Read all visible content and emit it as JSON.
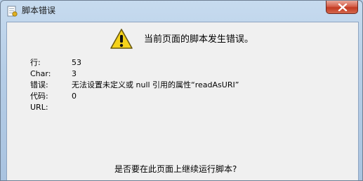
{
  "window": {
    "title": "脚本错误",
    "close_icon": "close-icon"
  },
  "dialog": {
    "icon": "warning-icon",
    "headline": "当前页面的脚本发生错误。",
    "details": [
      {
        "label": "行:",
        "value": "53"
      },
      {
        "label": "Char:",
        "value": "3"
      },
      {
        "label": "错误:",
        "value": "无法设置未定义或 null 引用的属性“readAsURI”"
      },
      {
        "label": "代码:",
        "value": "0"
      },
      {
        "label": "URL:",
        "value": ""
      }
    ],
    "question": "是否要在此页面上继续运行脚本?"
  },
  "colors": {
    "accent_warning": "#f5d21a",
    "close_button": "#c23a22"
  }
}
